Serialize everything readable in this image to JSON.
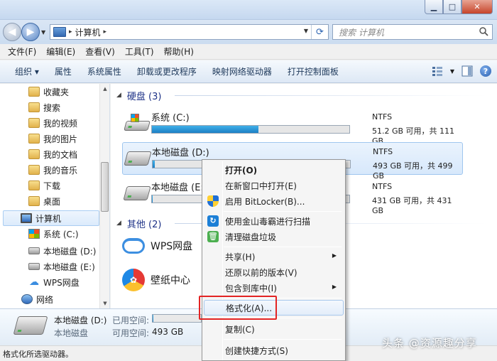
{
  "window": {
    "min_glyph": "▁",
    "max_glyph": "□",
    "close_glyph": "✕"
  },
  "address": {
    "path": "计算机",
    "sep_glyph": "▸",
    "search_placeholder": "搜索 计算机"
  },
  "menu": [
    "文件(F)",
    "编辑(E)",
    "查看(V)",
    "工具(T)",
    "帮助(H)"
  ],
  "toolbar": {
    "organize": "组织 ▾",
    "items": [
      "属性",
      "系统属性",
      "卸载或更改程序",
      "映射网络驱动器",
      "打开控制面板"
    ]
  },
  "nav": {
    "items": [
      {
        "label": "收藏夹",
        "icon": "folder-icon"
      },
      {
        "label": "搜索",
        "icon": "folder-icon"
      },
      {
        "label": "我的视频",
        "icon": "folder-icon"
      },
      {
        "label": "我的图片",
        "icon": "folder-icon"
      },
      {
        "label": "我的文档",
        "icon": "folder-icon"
      },
      {
        "label": "我的音乐",
        "icon": "folder-icon"
      },
      {
        "label": "下载",
        "icon": "folder-icon"
      },
      {
        "label": "桌面",
        "icon": "folder-icon"
      },
      {
        "label": "计算机",
        "icon": "computer-icon"
      },
      {
        "label": "系统 (C:)",
        "icon": "sys-icon"
      },
      {
        "label": "本地磁盘 (D:)",
        "icon": "drive-icon"
      },
      {
        "label": "本地磁盘 (E:)",
        "icon": "drive-icon"
      },
      {
        "label": "WPS网盘",
        "icon": "cloud-icon"
      },
      {
        "label": "网络",
        "icon": "network-icon"
      }
    ]
  },
  "groups": {
    "hdd": "硬盘 (3)",
    "other": "其他 (2)"
  },
  "drives": [
    {
      "name": "系统 (C:)",
      "fs": "NTFS",
      "space": "51.2 GB 可用，共 111 GB",
      "used_fraction": 0.54
    },
    {
      "name": "本地磁盘 (D:)",
      "fs": "NTFS",
      "space": "493 GB 可用，共 499 GB",
      "used_fraction": 0.012
    },
    {
      "name": "本地磁盘 (E:)",
      "fs": "NTFS",
      "space": "431 GB 可用，共 431 GB",
      "used_fraction": 0.003
    }
  ],
  "others": [
    {
      "name": "WPS网盘"
    },
    {
      "name": "壁纸中心"
    }
  ],
  "details": {
    "name": "本地磁盘 (D:)",
    "type": "本地磁盘",
    "used_label": "已用空间:",
    "free_label": "可用空间:",
    "free_value": "493 GB",
    "used_fraction": 0.012
  },
  "status": "格式化所选驱动器。",
  "context_menu": {
    "open": "打开(O)",
    "new_window": "在新窗口中打开(E)",
    "bitlocker": "启用 BitLocker(B)...",
    "scan": "使用金山毒霸进行扫描",
    "clean": "清理磁盘垃圾",
    "share": "共享(H)",
    "restore": "还原以前的版本(V)",
    "library": "包含到库中(I)",
    "format": "格式化(A)...",
    "copy": "复制(C)",
    "shortcut": "创建快捷方式(S)"
  },
  "watermark": "头条 @资源趣分享",
  "colors": {
    "accent": "#1c7fc4",
    "highlight_box": "#e32424"
  }
}
